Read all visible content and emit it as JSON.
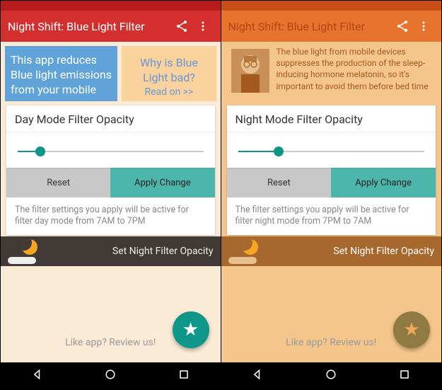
{
  "left": {
    "statusColor": "#b71c1c",
    "barColor": "#d32f2f",
    "title": "Night Shift: Blue Light Filter",
    "info1": "This app reduces Blue light emissions from your mobile",
    "info2a": "Why is Blue Light bad?",
    "info2b": "Read on >>",
    "cardTitle": "Day Mode Filter Opacity",
    "sliderPct": 12,
    "reset": "Reset",
    "apply": "Apply Change",
    "desc": "The filter settings you apply will be active for filter day mode from 7AM to 7PM",
    "nightLabel": "Set Night Filter Opacity",
    "footer": "Like app? Review us!"
  },
  "right": {
    "statusColor": "#c94f17",
    "barColor": "#e6732e",
    "title": "Night Shift: Blue Light Filter",
    "infoText": "The blue light from mobile devices suppresses the production of the sleep-inducing hormone melatonin, so it's important to avoid them before bed time",
    "cardTitle": "Night Mode Filter Opacity",
    "sliderPct": 22,
    "reset": "Reset",
    "apply": "Apply Change",
    "desc": "The filter settings you apply will be active for filter night mode from 7PM to 7AM",
    "nightLabel": "Set Night Filter Opacity",
    "footer": "Like app? Review us!"
  }
}
